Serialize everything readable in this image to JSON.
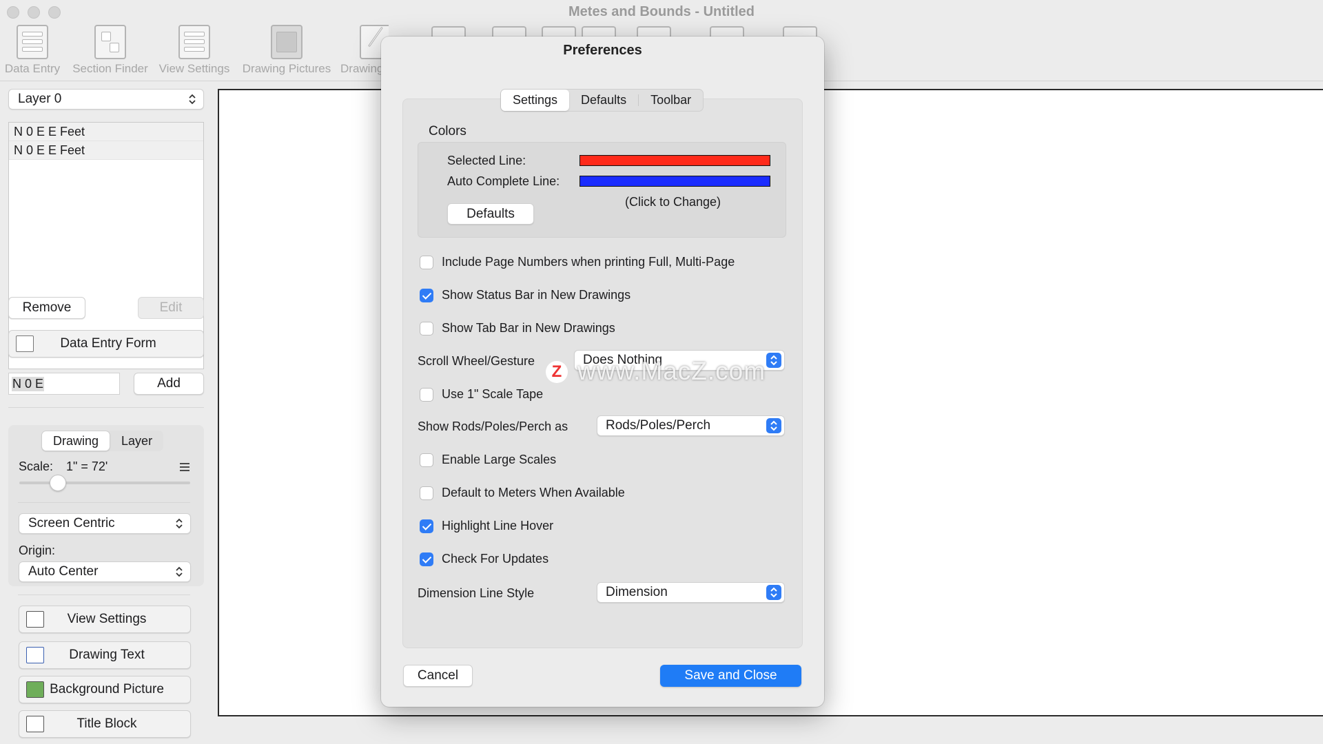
{
  "window": {
    "title": "Metes and Bounds - Untitled"
  },
  "toolbar": {
    "items": [
      {
        "label": "Data Entry",
        "icon": "data-entry-icon"
      },
      {
        "label": "Section Finder",
        "icon": "section-finder-icon"
      },
      {
        "label": "View Settings",
        "icon": "view-settings-icon"
      },
      {
        "label": "Drawing Pictures",
        "icon": "drawing-pictures-icon"
      },
      {
        "label": "Drawing",
        "icon": "drawing-text-icon"
      }
    ]
  },
  "sidebar": {
    "layer_select": "Layer 0",
    "calls": [
      "N 0 E E Feet",
      "N 0 E E Feet"
    ],
    "remove_label": "Remove",
    "edit_label": "Edit",
    "data_entry_form_label": "Data Entry Form",
    "call_input_value": "N 0 E",
    "add_label": "Add",
    "tabs": {
      "drawing": "Drawing",
      "layer": "Layer",
      "active": "Drawing"
    },
    "scale_label": "Scale:",
    "scale_value": "1\" = 72'",
    "centering_select": "Screen Centric",
    "origin_label": "Origin:",
    "origin_select": "Auto Center",
    "buttons": {
      "view_settings": "View Settings",
      "drawing_text": "Drawing Text",
      "background_picture": "Background Picture",
      "title_block": "Title Block"
    }
  },
  "dialog": {
    "title": "Preferences",
    "tabs": [
      "Settings",
      "Defaults",
      "Toolbar"
    ],
    "active_tab": "Settings",
    "colors": {
      "heading": "Colors",
      "selected_line_label": "Selected Line:",
      "selected_line_color": "#ff2a1a",
      "auto_complete_line_label": "Auto Complete Line:",
      "auto_complete_line_color": "#1a2cff",
      "hint": "(Click to Change)",
      "defaults_button": "Defaults"
    },
    "options": {
      "page_numbers": {
        "label": "Include Page Numbers when printing Full, Multi-Page",
        "checked": false
      },
      "status_bar": {
        "label": "Show Status Bar in New Drawings",
        "checked": true
      },
      "tab_bar": {
        "label": "Show Tab Bar in New Drawings",
        "checked": false
      },
      "scale_tape": {
        "label": "Use 1\" Scale Tape",
        "checked": false
      },
      "large_scales": {
        "label": "Enable Large Scales",
        "checked": false
      },
      "meters": {
        "label": "Default to Meters When Available",
        "checked": false
      },
      "highlight_hover": {
        "label": "Highlight Line Hover",
        "checked": true
      },
      "check_updates": {
        "label": "Check For Updates",
        "checked": true
      }
    },
    "scroll_wheel": {
      "label": "Scroll Wheel/Gesture",
      "value": "Does Nothing"
    },
    "rods": {
      "label": "Show Rods/Poles/Perch as",
      "value": "Rods/Poles/Perch"
    },
    "dimension_style": {
      "label": "Dimension Line Style",
      "value": "Dimension"
    },
    "cancel_label": "Cancel",
    "save_label": "Save and Close"
  },
  "watermark": {
    "logo": "Z",
    "text": "www.MacZ.com"
  },
  "accent_color": "#1f7cf6"
}
